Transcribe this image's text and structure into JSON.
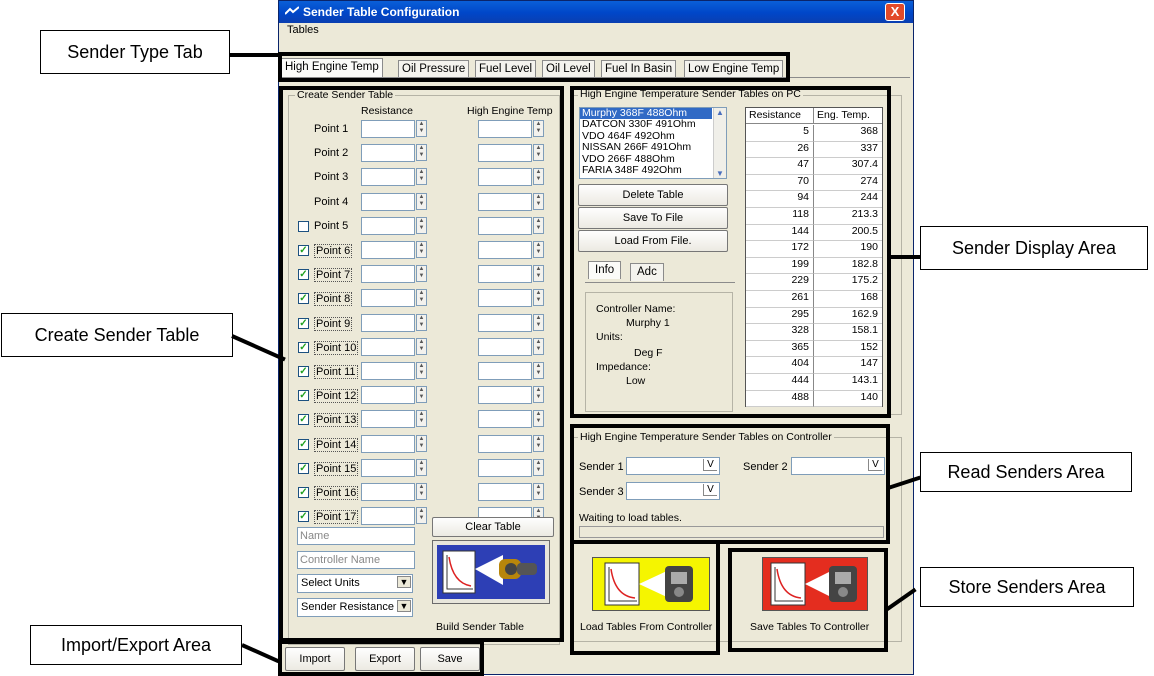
{
  "window": {
    "title": "Sender Table Configuration",
    "close_label": "X",
    "menu": [
      "Tables"
    ]
  },
  "tabs": [
    "High Engine Temp",
    "Oil Pressure",
    "Fuel Level",
    "Oil Level",
    "Fuel In Basin",
    "Low Engine Temp"
  ],
  "create_table": {
    "legend": "Create Sender Table",
    "col_resistance": "Resistance",
    "col_temp": "High Engine Temp",
    "points": [
      {
        "label": "Point 1",
        "checkbox": false,
        "checked": false
      },
      {
        "label": "Point 2",
        "checkbox": false,
        "checked": false
      },
      {
        "label": "Point 3",
        "checkbox": false,
        "checked": false
      },
      {
        "label": "Point 4",
        "checkbox": false,
        "checked": false
      },
      {
        "label": "Point 5",
        "checkbox": true,
        "checked": false
      },
      {
        "label": "Point 6",
        "checkbox": true,
        "checked": true
      },
      {
        "label": "Point 7",
        "checkbox": true,
        "checked": true
      },
      {
        "label": "Point 8",
        "checkbox": true,
        "checked": true
      },
      {
        "label": "Point 9",
        "checkbox": true,
        "checked": true
      },
      {
        "label": "Point 10",
        "checkbox": true,
        "checked": true
      },
      {
        "label": "Point 11",
        "checkbox": true,
        "checked": true
      },
      {
        "label": "Point 12",
        "checkbox": true,
        "checked": true
      },
      {
        "label": "Point 13",
        "checkbox": true,
        "checked": true
      },
      {
        "label": "Point 14",
        "checkbox": true,
        "checked": true
      },
      {
        "label": "Point 15",
        "checkbox": true,
        "checked": true
      },
      {
        "label": "Point 16",
        "checkbox": true,
        "checked": true
      },
      {
        "label": "Point 17",
        "checkbox": true,
        "checked": true
      }
    ],
    "name_placeholder": "Name",
    "controller_placeholder": "Controller Name",
    "units_select": "Select Units",
    "type_select": "Sender Resistance",
    "clear_button": "Clear Table",
    "build_button": "Build Sender Table"
  },
  "pc_tables": {
    "legend": "High Engine Temperature Sender Tables on PC",
    "list": [
      "Murphy 368F 488Ohm",
      "DATCON 330F 491Ohm",
      "VDO 464F 492Ohm",
      "NISSAN 266F 491Ohm",
      "VDO 266F 488Ohm",
      "FARIA 348F 492Ohm"
    ],
    "selected_index": 0,
    "delete_button": "Delete Table",
    "save_file_button": "Save To File",
    "load_file_button": "Load From File.",
    "info_tabs": [
      "Info",
      "Adc"
    ],
    "info": {
      "controller_label": "Controller Name:",
      "controller_value": "Murphy 1",
      "units_label": "Units:",
      "units_value": "Deg F",
      "impedance_label": "Impedance:",
      "impedance_value": "Low"
    },
    "grid_headers": [
      "Resistance",
      "Eng. Temp."
    ],
    "grid_rows": [
      [
        "5",
        "368"
      ],
      [
        "26",
        "337"
      ],
      [
        "47",
        "307.4"
      ],
      [
        "70",
        "274"
      ],
      [
        "94",
        "244"
      ],
      [
        "118",
        "213.3"
      ],
      [
        "144",
        "200.5"
      ],
      [
        "172",
        "190"
      ],
      [
        "199",
        "182.8"
      ],
      [
        "229",
        "175.2"
      ],
      [
        "261",
        "168"
      ],
      [
        "295",
        "162.9"
      ],
      [
        "328",
        "158.1"
      ],
      [
        "365",
        "152"
      ],
      [
        "404",
        "147"
      ],
      [
        "444",
        "143.1"
      ],
      [
        "488",
        "140"
      ]
    ]
  },
  "controller_tables": {
    "legend": "High Engine Temperature Sender Tables on Controller",
    "sender1": "Sender 1",
    "sender2": "Sender 2",
    "sender3": "Sender 3",
    "drop_glyph": "V",
    "status": "Waiting to load tables.",
    "load_button": "Load Tables From Controller",
    "save_button": "Save Tables To Controller"
  },
  "bottom_buttons": [
    "Import",
    "Export",
    "Save"
  ],
  "callouts": {
    "sender_type_tab": "Sender Type Tab",
    "create_sender_table": "Create Sender Table",
    "import_export": "Import/Export Area",
    "sender_display": "Sender Display Area",
    "read_senders": "Read Senders Area",
    "store_senders": "Store Senders Area"
  },
  "colors": {
    "title_bar": "#0a5fd8",
    "window_bg": "#ece9d8",
    "load_panel": "#f5f500",
    "save_panel": "#e42d1f",
    "build_panel": "#2d3fb5",
    "selection": "#316ac5"
  }
}
